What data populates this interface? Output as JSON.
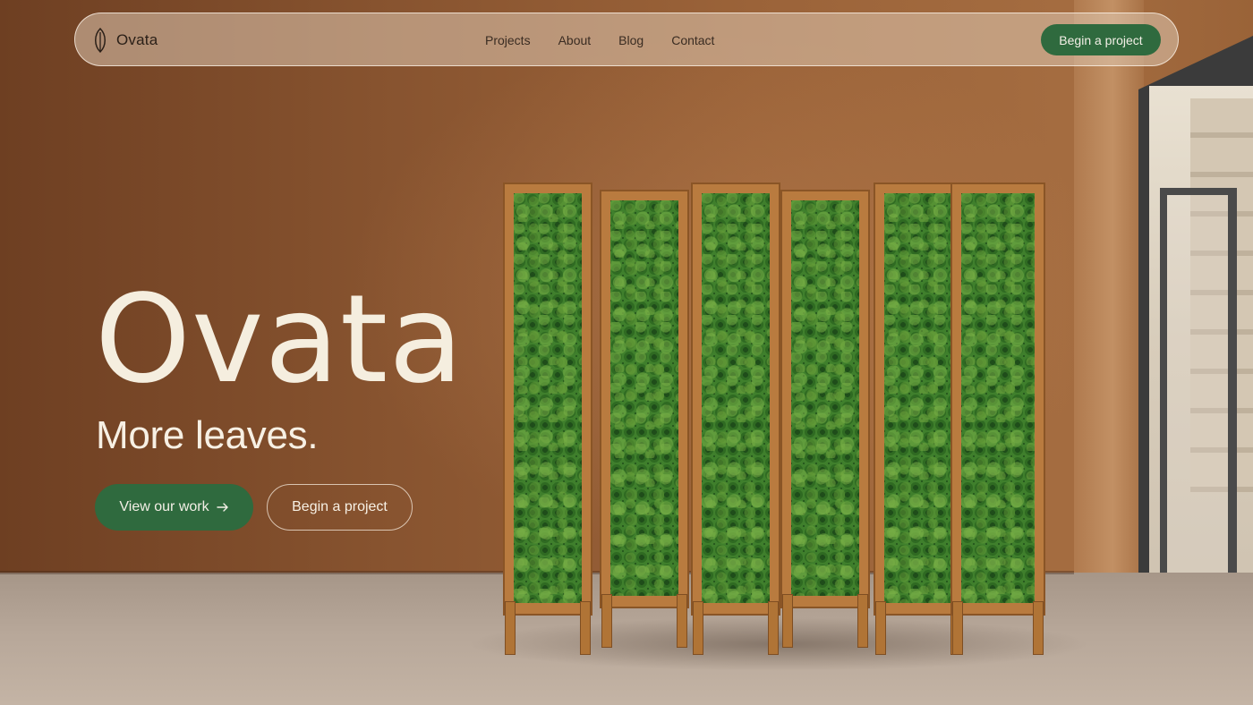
{
  "brand": {
    "name": "Ovata",
    "icon": "leaf-icon"
  },
  "nav": {
    "links": [
      {
        "label": "Projects"
      },
      {
        "label": "About"
      },
      {
        "label": "Blog"
      },
      {
        "label": "Contact"
      }
    ],
    "cta_label": "Begin a project"
  },
  "hero": {
    "title": "Ovata",
    "subtitle": "More leaves.",
    "primary_label": "View our work",
    "primary_icon": "arrow-right-icon",
    "secondary_label": "Begin a project"
  },
  "colors": {
    "accent_green": "#2f6a3e",
    "wall": "#8a5632",
    "cream_text": "#f5eedf"
  }
}
